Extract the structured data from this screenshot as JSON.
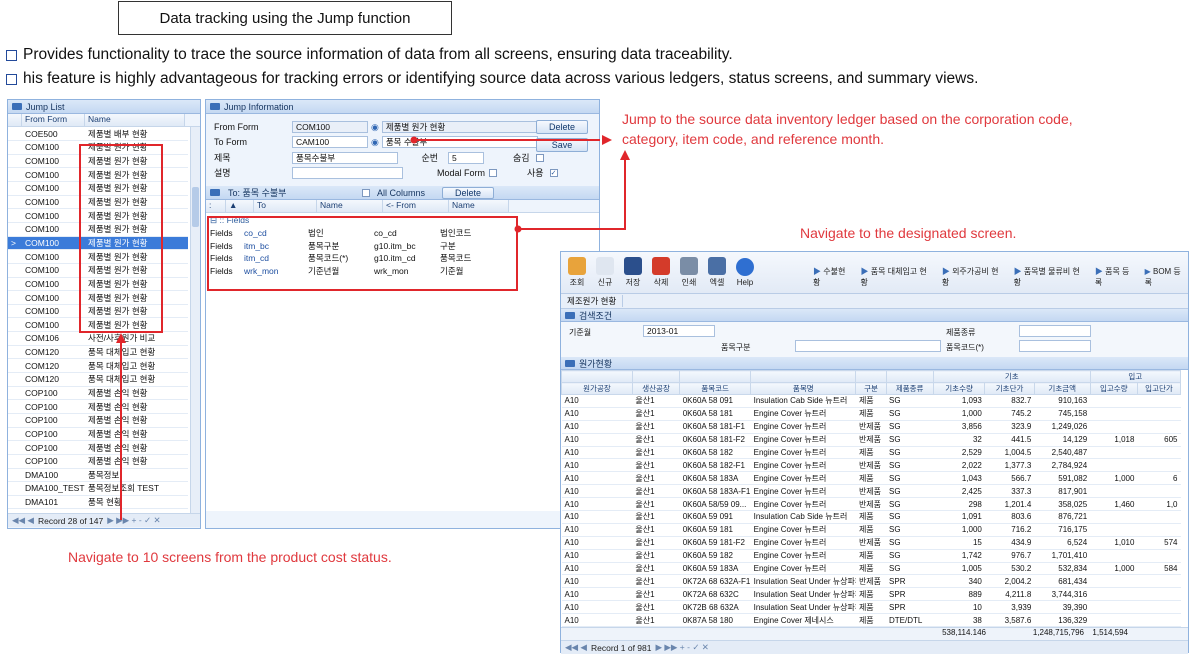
{
  "title": "Data tracking using the Jump function",
  "bullets": [
    "Provides functionality to trace the source information of data from all screens, ensuring data traceability.",
    "his feature is highly advantageous for tracking errors or identifying source data across various ledgers, status screens, and summary views."
  ],
  "annotations": {
    "jump_source": "Jump to the source data inventory ledger based on the corporation code, category, item code, and reference month.",
    "navigate_designated": "Navigate to the designated screen.",
    "navigate_ten": "Navigate to 10 screens from the product cost status."
  },
  "jump_list": {
    "title": "Jump List",
    "col_from": "From Form",
    "col_name": "Name",
    "rows": [
      [
        "COE500",
        "제품별 배부 현황"
      ],
      [
        "COM100",
        "제품별 원가 현황"
      ],
      [
        "COM100",
        "제품별 원가 현황"
      ],
      [
        "COM100",
        "제품별 원가 현황"
      ],
      [
        "COM100",
        "제품별 원가 현황"
      ],
      [
        "COM100",
        "제품별 원가 현황"
      ],
      [
        "COM100",
        "제품별 원가 현황"
      ],
      [
        "COM100",
        "제품별 원가 현황"
      ],
      [
        "COM100",
        "제품별 원가 현황"
      ],
      [
        "COM100",
        "제품별 원가 현황"
      ],
      [
        "COM100",
        "제품별 원가 현황"
      ],
      [
        "COM100",
        "제품별 원가 현황"
      ],
      [
        "COM100",
        "제품별 원가 현황"
      ],
      [
        "COM100",
        "제품별 원가 현황"
      ],
      [
        "COM100",
        "제품별 원가 현황"
      ],
      [
        "COM106",
        "사전/사후원가 비교"
      ],
      [
        "COM120",
        "품목 대체입고 현황"
      ],
      [
        "COM120",
        "품목 대체입고 현황"
      ],
      [
        "COM120",
        "품목 대체입고 현황"
      ],
      [
        "COP100",
        "제품별 손익 현황"
      ],
      [
        "COP100",
        "제품별 손익 현황"
      ],
      [
        "COP100",
        "제품별 손익 현황"
      ],
      [
        "COP100",
        "제품별 손익 현황"
      ],
      [
        "COP100",
        "제품별 손익 현황"
      ],
      [
        "COP100",
        "제품별 손익 현황"
      ],
      [
        "DMA100",
        "품목정보"
      ],
      [
        "DMA100_TEST",
        "품목정보조회 TEST"
      ],
      [
        "DMA101",
        "품목 현황"
      ]
    ],
    "selected_index": 8,
    "record": "Record 28 of 147"
  },
  "jump_info": {
    "title": "Jump Information",
    "from_form_label": "From Form",
    "from_form_code": "COM100",
    "from_form_name": "제품별 원가 현황",
    "to_form_label": "To Form",
    "to_form_code": "CAM100",
    "to_form_name": "품목 수불부",
    "subject_label": "제목",
    "subject_value": "품목수불부",
    "order_label": "순번",
    "order_value": "5",
    "close_label": "숨김",
    "desc_label": "설명",
    "modal_label": "Modal Form",
    "use_label": "사용",
    "delete_label": "Delete",
    "save_label": "Save"
  },
  "to_panel": {
    "title": "To: 품목 수불부",
    "all_columns": "All Columns",
    "delete_label": "Delete",
    "col_to": "To",
    "col_name": "Name",
    "col_from": "<- From",
    "col_name2": "Name",
    "group": "Fields",
    "rows": [
      [
        "Fields",
        "co_cd",
        "법인",
        "co_cd",
        "법인코드"
      ],
      [
        "Fields",
        "itm_bc",
        "품목구분",
        "g10.itm_bc",
        "구분"
      ],
      [
        "Fields",
        "itm_cd",
        "품목코드(*)",
        "g10.itm_cd",
        "품목코드"
      ],
      [
        "Fields",
        "wrk_mon",
        "기준년월",
        "wrk_mon",
        "기준월"
      ]
    ]
  },
  "cost_window": {
    "toolbar": [
      "조회",
      "신규",
      "저장",
      "삭제",
      "인쇄",
      "엑셀",
      "Help"
    ],
    "breadcrumbs": [
      "수불현황",
      "품목 대체입고 현황",
      "외주가공비 현황",
      "품목별 물류비 현황",
      "품목 등록",
      "BOM 등록"
    ],
    "tab": "제조원가 현황",
    "search_title": "검색조건",
    "base_month_label": "기준월",
    "base_month": "2013-01",
    "item_type_label": "품목구분",
    "product_type_label": "제품종류",
    "item_code_label": "품목코드(*)",
    "grid_title": "원가현황",
    "group_base": "기초",
    "group_in": "입고",
    "headers": [
      "원가공장",
      "생산공장",
      "품목코드",
      "품목명",
      "구분",
      "제품종류",
      "기초수량",
      "기초단가",
      "기초금액",
      "입고수량",
      "입고단가"
    ],
    "rows": [
      [
        "A10",
        "울산1",
        "0K60A 58 091",
        "Insulation Cab Side 뉴트러",
        "제품",
        "SG",
        "1,093",
        "832.7",
        "910,163",
        "",
        ""
      ],
      [
        "A10",
        "울산1",
        "0K60A 58 181",
        "Engine Cover 뉴트러",
        "제품",
        "SG",
        "1,000",
        "745.2",
        "745,158",
        "",
        ""
      ],
      [
        "A10",
        "울산1",
        "0K60A 58 181-F1",
        "Engine Cover 뉴트러",
        "반제품",
        "SG",
        "3,856",
        "323.9",
        "1,249,026",
        "",
        ""
      ],
      [
        "A10",
        "울산1",
        "0K60A 58 181-F2",
        "Engine Cover 뉴트러",
        "반제품",
        "SG",
        "32",
        "441.5",
        "14,129",
        "1,018",
        "605"
      ],
      [
        "A10",
        "울산1",
        "0K60A 58 182",
        "Engine Cover 뉴트러",
        "제품",
        "SG",
        "2,529",
        "1,004.5",
        "2,540,487",
        "",
        ""
      ],
      [
        "A10",
        "울산1",
        "0K60A 58 182-F1",
        "Engine Cover 뉴트러",
        "반제품",
        "SG",
        "2,022",
        "1,377.3",
        "2,784,924",
        "",
        ""
      ],
      [
        "A10",
        "울산1",
        "0K60A 58 183A",
        "Engine Cover 뉴트러",
        "제품",
        "SG",
        "1,043",
        "566.7",
        "591,082",
        "1,000",
        "6"
      ],
      [
        "A10",
        "울산1",
        "0K60A 58 183A-F1",
        "Engine Cover 뉴트러",
        "반제품",
        "SG",
        "2,425",
        "337.3",
        "817,901",
        "",
        ""
      ],
      [
        "A10",
        "울산1",
        "0K60A 58/59 09...",
        "Engine Cover 뉴트러",
        "반제품",
        "SG",
        "298",
        "1,201.4",
        "358,025",
        "1,460",
        "1,0"
      ],
      [
        "A10",
        "울산1",
        "0K60A 59 091",
        "Insulation Cab Side 뉴트러",
        "제품",
        "SG",
        "1,091",
        "803.6",
        "876,721",
        "",
        ""
      ],
      [
        "A10",
        "울산1",
        "0K60A 59 181",
        "Engine Cover 뉴트러",
        "제품",
        "SG",
        "1,000",
        "716.2",
        "716,175",
        "",
        ""
      ],
      [
        "A10",
        "울산1",
        "0K60A 59 181-F2",
        "Engine Cover 뉴트러",
        "반제품",
        "SG",
        "15",
        "434.9",
        "6,524",
        "1,010",
        "574"
      ],
      [
        "A10",
        "울산1",
        "0K60A 59 182",
        "Engine Cover 뉴트러",
        "제품",
        "SG",
        "1,742",
        "976.7",
        "1,701,410",
        "",
        ""
      ],
      [
        "A10",
        "울산1",
        "0K60A 59 183A",
        "Engine Cover 뉴트러",
        "제품",
        "SG",
        "1,005",
        "530.2",
        "532,834",
        "1,000",
        "584"
      ],
      [
        "A10",
        "울산1",
        "0K72A 68 632A-F1",
        "Insulation Seat Under 뉴상파페",
        "반제품",
        "SPR",
        "340",
        "2,004.2",
        "681,434",
        "",
        ""
      ],
      [
        "A10",
        "울산1",
        "0K72A 68 632C",
        "Insulation Seat Under 뉴상파페",
        "제품",
        "SPR",
        "889",
        "4,211.8",
        "3,744,316",
        "",
        ""
      ],
      [
        "A10",
        "울산1",
        "0K72B 68 632A",
        "Insulation Seat Under 뉴상파페",
        "제품",
        "SPR",
        "10",
        "3,939",
        "39,390",
        "",
        ""
      ],
      [
        "A10",
        "울산1",
        "0K87A 58 180",
        "Engine Cover 제네시스",
        "제품",
        "DTE/DTL",
        "38",
        "3,587.6",
        "136,329",
        "",
        ""
      ]
    ],
    "totals": [
      "538,114.146",
      "1,248,715,796",
      "1,514,594"
    ],
    "record": "Record 1 of 981"
  }
}
